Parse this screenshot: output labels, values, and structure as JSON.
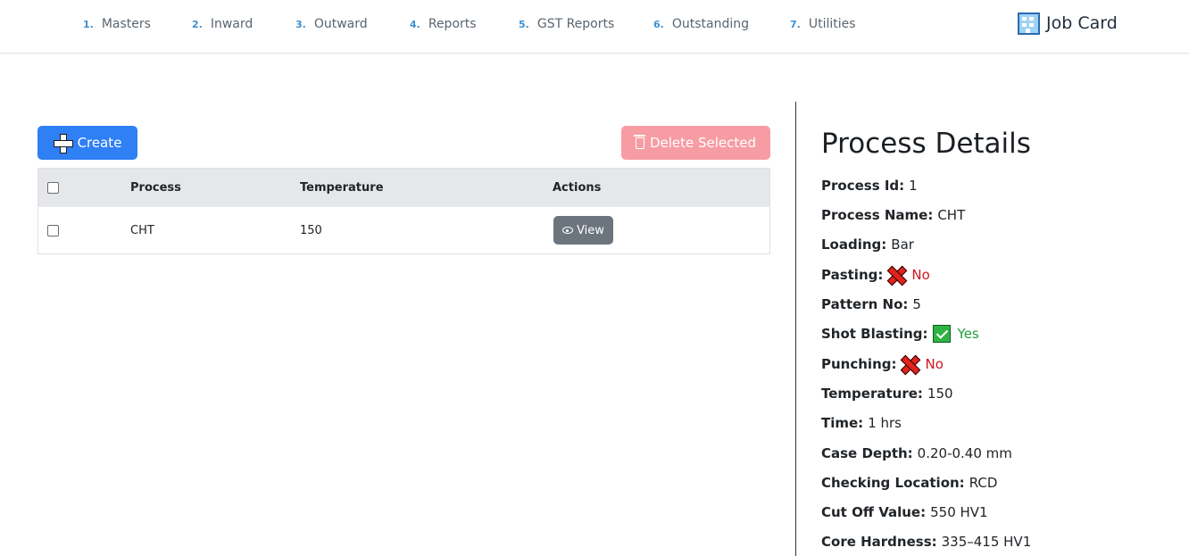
{
  "nav": {
    "items": [
      {
        "num": "1.",
        "label": "Masters"
      },
      {
        "num": "2.",
        "label": "Inward"
      },
      {
        "num": "3.",
        "label": "Outward"
      },
      {
        "num": "4.",
        "label": "Reports"
      },
      {
        "num": "5.",
        "label": "GST Reports"
      },
      {
        "num": "6.",
        "label": "Outstanding"
      },
      {
        "num": "7.",
        "label": "Utilities"
      }
    ],
    "brand": "Job Card",
    "brand_icon": "building-icon"
  },
  "toolbar": {
    "create_label": "Create",
    "delete_label": "Delete Selected"
  },
  "table": {
    "headers": {
      "process": "Process",
      "temperature": "Temperature",
      "actions": "Actions"
    },
    "rows": [
      {
        "process": "CHT",
        "temperature": "150",
        "action_label": "View"
      }
    ]
  },
  "details": {
    "title": "Process Details",
    "fields": [
      {
        "label": "Process Id:",
        "value": "1"
      },
      {
        "label": "Process Name:",
        "value": "CHT"
      },
      {
        "label": "Loading:",
        "value": "Bar"
      },
      {
        "label": "Pasting:",
        "value": "No",
        "status": "no"
      },
      {
        "label": "Pattern No:",
        "value": "5"
      },
      {
        "label": "Shot Blasting:",
        "value": "Yes",
        "status": "yes"
      },
      {
        "label": "Punching:",
        "value": "No",
        "status": "no"
      },
      {
        "label": "Temperature:",
        "value": "150"
      },
      {
        "label": "Time:",
        "value": "1 hrs"
      },
      {
        "label": "Case Depth:",
        "value": "0.20-0.40 mm"
      },
      {
        "label": "Checking Location:",
        "value": "RCD"
      },
      {
        "label": "Cut Off Value:",
        "value": "550 HV1"
      },
      {
        "label": "Core Hardness:",
        "value": "335–415 HV1"
      }
    ]
  },
  "colors": {
    "primary": "#2f7ff5",
    "danger_disabled": "#f79ca3",
    "secondary": "#6c757d",
    "status_no": "#d0151f",
    "status_yes": "#1f9d3a",
    "nav_number": "#3d8fd1"
  }
}
